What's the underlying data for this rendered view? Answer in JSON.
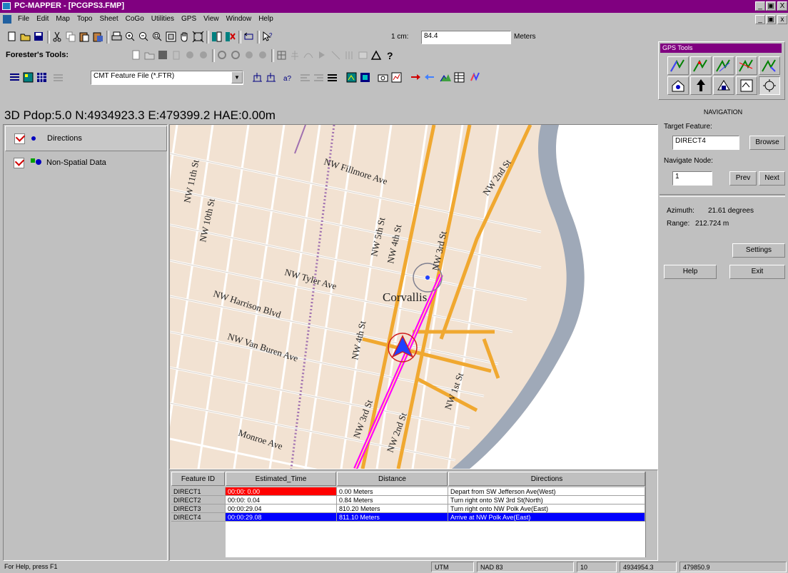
{
  "window": {
    "title": "PC-MAPPER - [PCGPS3.FMP]",
    "controls": [
      "_",
      "Ɖ",
      "X"
    ]
  },
  "menu": [
    "File",
    "Edit",
    "Map",
    "Topo",
    "Sheet",
    "CoGo",
    "Utilities",
    "GPS",
    "View",
    "Window",
    "Help"
  ],
  "toolbar": {
    "scale_label": "1 cm:",
    "scale_value": "84.4",
    "scale_units": "Meters"
  },
  "foresters": {
    "label": "Forester's Tools:"
  },
  "feature_file": {
    "selected": "CMT Feature File (*.FTR)"
  },
  "gps_status": "3D  Pdop:5.0  N:4934923.3  E:479399.2  HAE:0.00m",
  "legend": {
    "items": [
      {
        "label": "Directions"
      },
      {
        "label": "Non-Spatial Data"
      }
    ]
  },
  "map": {
    "streets": [
      "NW 11th St",
      "NW 10th St",
      "NW Fillmore Ave",
      "NW 5th St",
      "NW 4th St",
      "NW 3rd St",
      "NW 2nd St",
      "NW Tyler Ave",
      "NW Harrison Blvd",
      "NW Van Buren Ave",
      "NW 4th St",
      "NW 3rd St",
      "NW 2nd St",
      "NW 1st St",
      "Monroe Ave"
    ],
    "city": "Corvallis"
  },
  "grid": {
    "columns": [
      "Feature ID",
      "Estimated_Time",
      "Distance",
      "Directions"
    ],
    "rows": [
      {
        "id": "DIRECT1",
        "time": "00:00: 0.00",
        "distance": "0.00 Meters",
        "directions": "Depart from SW Jefferson Ave(West)"
      },
      {
        "id": "DIRECT2",
        "time": "00:00: 0.04",
        "distance": "0.84 Meters",
        "directions": "Turn right onto SW 3rd St(North)"
      },
      {
        "id": "DIRECT3",
        "time": "00:00:29.04",
        "distance": "810.20 Meters",
        "directions": "Turn right onto NW Polk Ave(East)"
      },
      {
        "id": "DIRECT4",
        "time": "00:00:29.08",
        "distance": "811.10 Meters",
        "directions": "Arrive at NW Polk Ave(East)"
      }
    ],
    "colors": {
      "highlight_red": "#ff0000",
      "selected_blue": "#0000ff"
    }
  },
  "gps_tools": {
    "title": "GPS Tools"
  },
  "navigation": {
    "title": "NAVIGATION",
    "target_label": "Target Feature:",
    "target_value": "DIRECT4",
    "browse": "Browse",
    "node_label": "Navigate Node:",
    "node_value": "1",
    "prev": "Prev",
    "next": "Next",
    "azimuth_label": "Azimuth:",
    "azimuth_value": "21.61 degrees",
    "range_label": "Range:",
    "range_value": "212.724 m",
    "settings": "Settings",
    "help": "Help",
    "exit": "Exit"
  },
  "statusbar": {
    "help": "For Help, press F1",
    "projection": "UTM",
    "datum": "NAD 83",
    "zone": "10",
    "northing": "4934954.3",
    "easting": "479850.9"
  }
}
